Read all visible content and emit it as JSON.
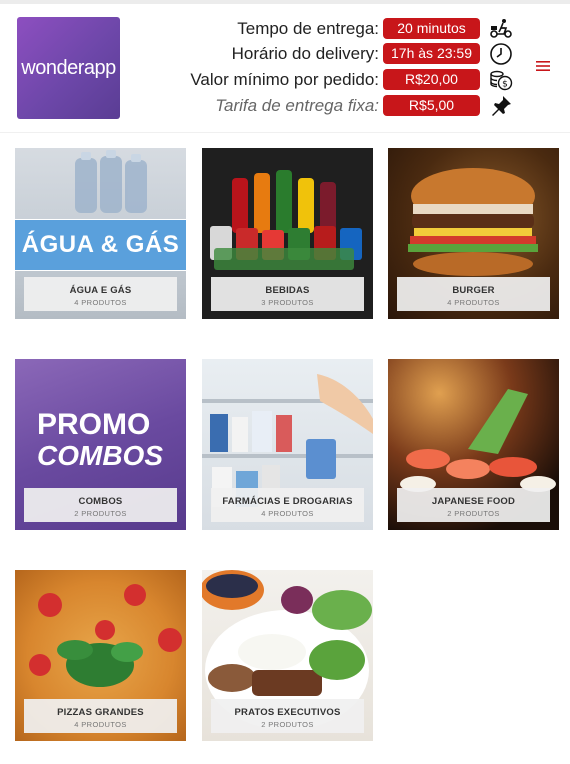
{
  "brand": {
    "logo_text": "wonderapp"
  },
  "info": [
    {
      "label": "Tempo de entrega:",
      "value": "20 minutos",
      "icon": "scooter-icon"
    },
    {
      "label": "Horário do delivery:",
      "value": "17h às 23:59",
      "icon": "clock-icon"
    },
    {
      "label": "Valor mínimo por pedido:",
      "value": "R$20,00",
      "icon": "coins-icon"
    },
    {
      "label": "Tarifa de entrega fixa:",
      "value": "R$5,00",
      "icon": "pin-icon"
    }
  ],
  "menu_icon": "hamburger-menu-icon",
  "colors": {
    "accent": "#c8161a",
    "brand": "#6d47a9"
  },
  "categories": [
    {
      "name": "Água e Gás",
      "count": "4 produtos",
      "banner": "ÁGUA & GÁS"
    },
    {
      "name": "Bebidas",
      "count": "3 produtos"
    },
    {
      "name": "Burger",
      "count": "4 produtos"
    },
    {
      "name": "Combos",
      "count": "2 produtos",
      "banner_line1": "PROMO",
      "banner_line2": "COMBOS"
    },
    {
      "name": "Farmácias e Drogarias",
      "count": "4 produtos"
    },
    {
      "name": "Japanese Food",
      "count": "2 produtos"
    },
    {
      "name": "Pizzas Grandes",
      "count": "4 produtos"
    },
    {
      "name": "Pratos Executivos",
      "count": "2 produtos"
    }
  ]
}
